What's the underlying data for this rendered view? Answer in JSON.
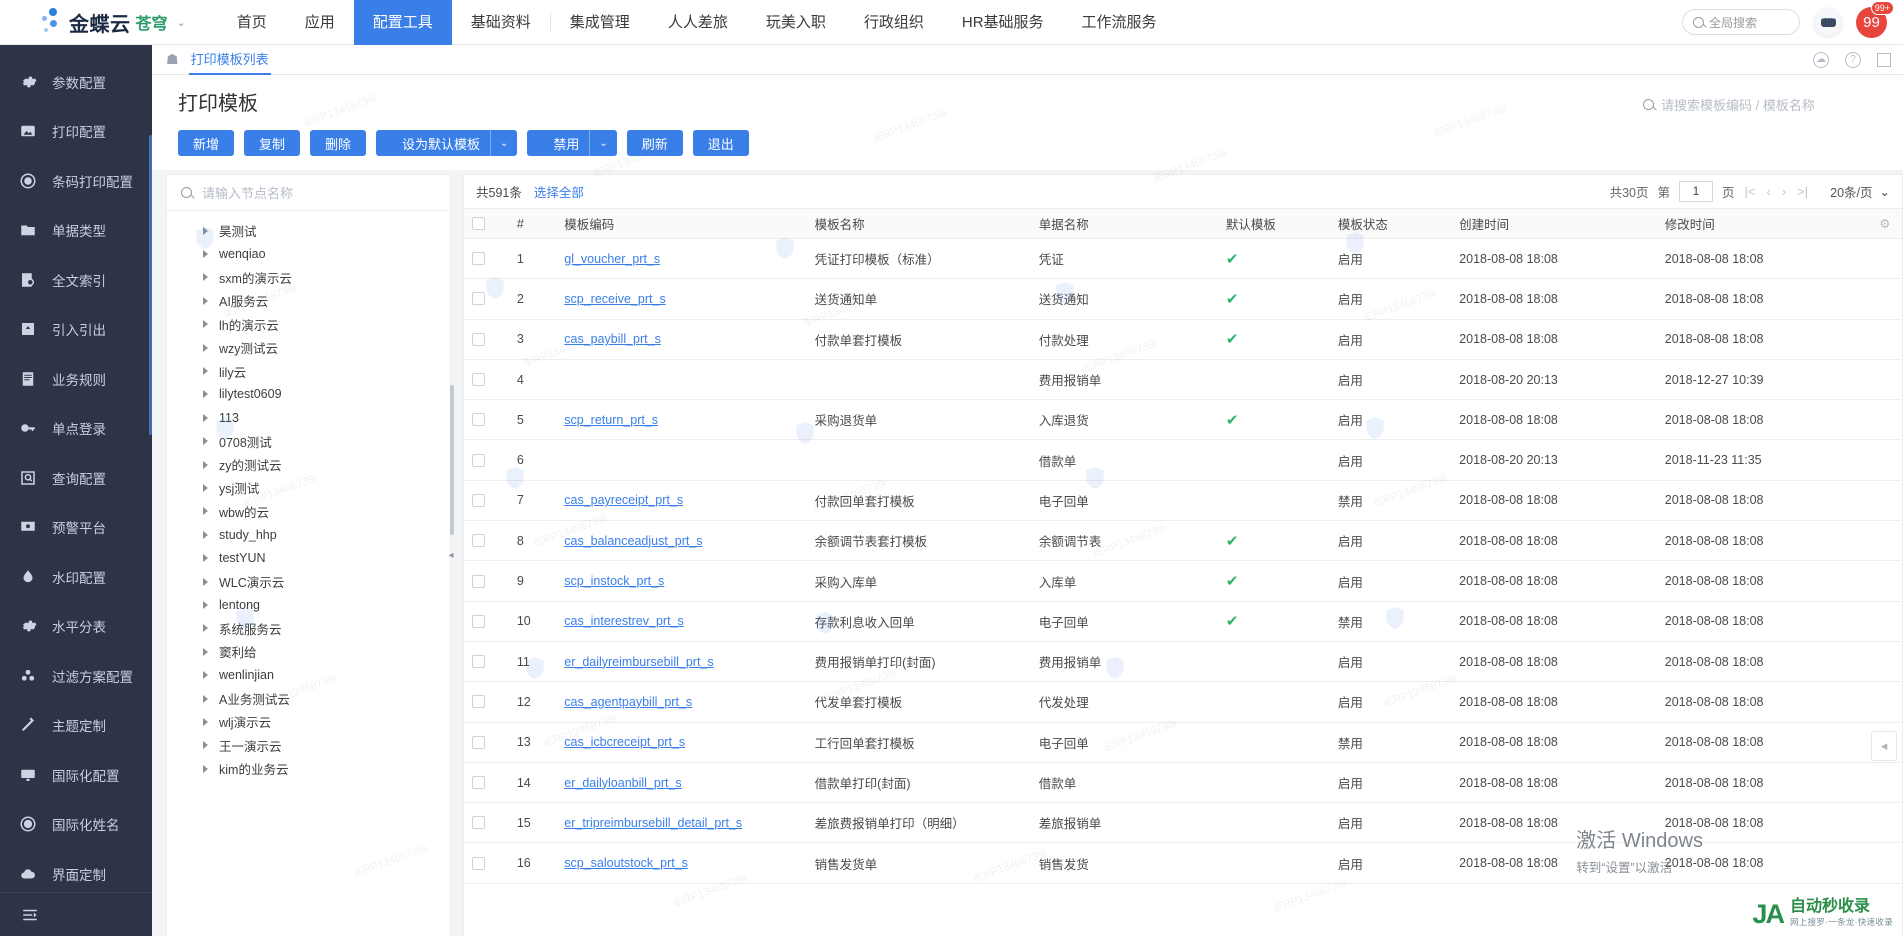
{
  "brand": {
    "name": "金蝶云",
    "sub": "苍穹",
    "caret": "⌄"
  },
  "topnav": {
    "items": [
      {
        "label": "首页",
        "active": false
      },
      {
        "label": "应用",
        "active": false
      },
      {
        "label": "配置工具",
        "active": true
      },
      {
        "label": "基础资料",
        "active": false
      },
      {
        "label": "集成管理",
        "active": false
      },
      {
        "label": "人人差旅",
        "active": false
      },
      {
        "label": "玩美入职",
        "active": false
      },
      {
        "label": "行政组织",
        "active": false
      },
      {
        "label": "HR基础服务",
        "active": false
      },
      {
        "label": "工作流服务",
        "active": false
      }
    ],
    "global_search_placeholder": "全局搜索",
    "avatar_text": "99",
    "avatar_badge": "99+",
    "accent": "#3a7fe8"
  },
  "sidebar": {
    "items": [
      {
        "label": "参数配置",
        "icon": "gear-icon"
      },
      {
        "label": "打印配置",
        "icon": "printer-icon"
      },
      {
        "label": "条码打印配置",
        "icon": "circle-icon"
      },
      {
        "label": "单据类型",
        "icon": "folder-icon"
      },
      {
        "label": "全文索引",
        "icon": "doc-search-icon"
      },
      {
        "label": "引入引出",
        "icon": "import-export-icon"
      },
      {
        "label": "业务规则",
        "icon": "book-icon"
      },
      {
        "label": "单点登录",
        "icon": "key-icon"
      },
      {
        "label": "查询配置",
        "icon": "query-icon"
      },
      {
        "label": "预警平台",
        "icon": "monitor-icon"
      },
      {
        "label": "水印配置",
        "icon": "watermark-icon"
      },
      {
        "label": "水平分表",
        "icon": "gear-icon"
      },
      {
        "label": "过滤方案配置",
        "icon": "filter-icon"
      },
      {
        "label": "主题定制",
        "icon": "brush-icon"
      },
      {
        "label": "国际化配置",
        "icon": "display-icon"
      },
      {
        "label": "国际化姓名",
        "icon": "circle-icon"
      },
      {
        "label": "界面定制",
        "icon": "cloud-icon"
      }
    ],
    "collapse_icon": "collapse-icon"
  },
  "breadcrumb": {
    "home_icon": "home-icon",
    "tab": "打印模板列表"
  },
  "page": {
    "title": "打印模板",
    "buttons": [
      {
        "label": "新增",
        "split": false
      },
      {
        "label": "复制",
        "split": false
      },
      {
        "label": "删除",
        "split": false
      },
      {
        "label": "设为默认模板",
        "split": true,
        "caret": "⌄"
      },
      {
        "label": "禁用",
        "split": true,
        "caret": "⌄"
      },
      {
        "label": "刷新",
        "split": false
      },
      {
        "label": "退出",
        "split": false
      }
    ],
    "template_search_placeholder": "请搜索模板编码 / 模板名称"
  },
  "tree": {
    "search_placeholder": "请输入节点名称",
    "nodes": [
      "昊测试",
      "wenqiao",
      "sxm的演示云",
      "AI服务云",
      "lh的演示云",
      "wzy测试云",
      "lily云",
      "lilytest0609",
      "113",
      "0708测试",
      "zy的测试云",
      "ysj测试",
      "wbw的云",
      "study_hhp",
      "testYUN",
      "WLC演示云",
      "lentong",
      "系统服务云",
      "窦利给",
      "wenlinjian",
      "A业务测试云",
      "wlj演示云",
      "王一演示云",
      "kim的业务云"
    ]
  },
  "table": {
    "total_text": "共591条",
    "select_all": "选择全部",
    "pager": {
      "total_pages": "共30页",
      "page_prefix": "第",
      "page_value": "1",
      "page_suffix": "页",
      "first": "|<",
      "prev": "‹",
      "next": "›",
      "last": ">|",
      "page_size": "20条/页",
      "caret": "⌄"
    },
    "columns": [
      "#",
      "模板编码",
      "模板名称",
      "单据名称",
      "默认模板",
      "模板状态",
      "创建时间",
      "修改时间"
    ],
    "rows": [
      {
        "no": "1",
        "code": "gl_voucher_prt_s",
        "name": "凭证打印模板（标准）",
        "bill": "凭证",
        "default": true,
        "status": "启用",
        "created": "2018-08-08 18:08",
        "modified": "2018-08-08 18:08"
      },
      {
        "no": "2",
        "code": "scp_receive_prt_s",
        "name": "送货通知单",
        "bill": "送货通知",
        "default": true,
        "status": "启用",
        "created": "2018-08-08 18:08",
        "modified": "2018-08-08 18:08"
      },
      {
        "no": "3",
        "code": "cas_paybill_prt_s",
        "name": "付款单套打模板",
        "bill": "付款处理",
        "default": true,
        "status": "启用",
        "created": "2018-08-08 18:08",
        "modified": "2018-08-08 18:08"
      },
      {
        "no": "4",
        "code": "",
        "name": "",
        "bill": "费用报销单",
        "default": false,
        "status": "启用",
        "created": "2018-08-20 20:13",
        "modified": "2018-12-27 10:39"
      },
      {
        "no": "5",
        "code": "scp_return_prt_s",
        "name": "采购退货单",
        "bill": "入库退货",
        "default": true,
        "status": "启用",
        "created": "2018-08-08 18:08",
        "modified": "2018-08-08 18:08"
      },
      {
        "no": "6",
        "code": "",
        "name": "",
        "bill": "借款单",
        "default": false,
        "status": "启用",
        "created": "2018-08-20 20:13",
        "modified": "2018-11-23 11:35"
      },
      {
        "no": "7",
        "code": "cas_payreceipt_prt_s",
        "name": "付款回单套打模板",
        "bill": "电子回单",
        "default": false,
        "status": "禁用",
        "created": "2018-08-08 18:08",
        "modified": "2018-08-08 18:08"
      },
      {
        "no": "8",
        "code": "cas_balanceadjust_prt_s",
        "name": "余额调节表套打模板",
        "bill": "余额调节表",
        "default": true,
        "status": "启用",
        "created": "2018-08-08 18:08",
        "modified": "2018-08-08 18:08"
      },
      {
        "no": "9",
        "code": "scp_instock_prt_s",
        "name": "采购入库单",
        "bill": "入库单",
        "default": true,
        "status": "启用",
        "created": "2018-08-08 18:08",
        "modified": "2018-08-08 18:08"
      },
      {
        "no": "10",
        "code": "cas_interestrev_prt_s",
        "name": "存款利息收入回单",
        "bill": "电子回单",
        "default": true,
        "status": "禁用",
        "created": "2018-08-08 18:08",
        "modified": "2018-08-08 18:08"
      },
      {
        "no": "11",
        "code": "er_dailyreimbursebill_prt_s",
        "name": "费用报销单打印(封面)",
        "bill": "费用报销单",
        "default": false,
        "status": "启用",
        "created": "2018-08-08 18:08",
        "modified": "2018-08-08 18:08"
      },
      {
        "no": "12",
        "code": "cas_agentpaybill_prt_s",
        "name": "代发单套打模板",
        "bill": "代发处理",
        "default": false,
        "status": "启用",
        "created": "2018-08-08 18:08",
        "modified": "2018-08-08 18:08"
      },
      {
        "no": "13",
        "code": "cas_icbcreceipt_prt_s",
        "name": "工行回单套打模板",
        "bill": "电子回单",
        "default": false,
        "status": "禁用",
        "created": "2018-08-08 18:08",
        "modified": "2018-08-08 18:08"
      },
      {
        "no": "14",
        "code": "er_dailyloanbill_prt_s",
        "name": "借款单打印(封面)",
        "bill": "借款单",
        "default": false,
        "status": "启用",
        "created": "2018-08-08 18:08",
        "modified": "2018-08-08 18:08"
      },
      {
        "no": "15",
        "code": "er_tripreimbursebill_detail_prt_s",
        "name": "差旅费报销单打印（明细）",
        "bill": "差旅报销单",
        "default": false,
        "status": "启用",
        "created": "2018-08-08 18:08",
        "modified": "2018-08-08 18:08"
      },
      {
        "no": "16",
        "code": "scp_saloutstock_prt_s",
        "name": "销售发货单",
        "bill": "销售发货",
        "default": false,
        "status": "启用",
        "created": "2018-08-08 18:08",
        "modified": "2018-08-08 18:08"
      }
    ],
    "check_glyph": "✔",
    "settings_icon": "gear-icon"
  },
  "watermark": {
    "text": "iERP13466739i"
  },
  "activate": {
    "line1": "激活 Windows",
    "line2": "转到“设置”以激活"
  },
  "corner_logo": {
    "mark": "JA",
    "title": "自动秒收录",
    "subtitle": "网上搜罗·一条龙·快速收录"
  }
}
